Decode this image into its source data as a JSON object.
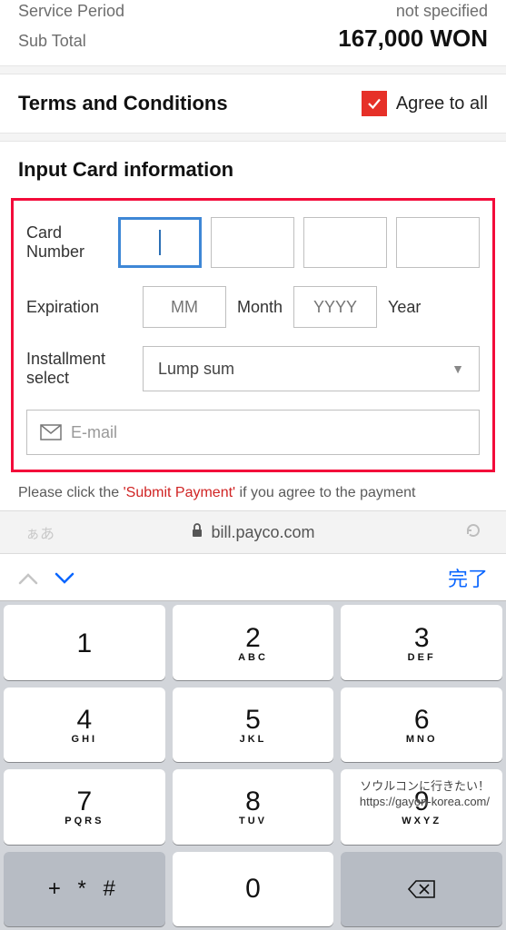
{
  "summary": {
    "service_period_label": "Service Period",
    "service_period_value": "not specified",
    "subtotal_label": "Sub Total",
    "subtotal_value": "167,000 WON"
  },
  "terms": {
    "title": "Terms and Conditions",
    "agree_label": "Agree to all",
    "checked": true
  },
  "card": {
    "section_title": "Input Card information",
    "number_label": "Card Number",
    "expiration_label": "Expiration",
    "mm_placeholder": "MM",
    "month_text": "Month",
    "yyyy_placeholder": "YYYY",
    "year_text": "Year",
    "installment_label": "Installment select",
    "installment_value": "Lump sum",
    "email_placeholder": "E-mail"
  },
  "note": {
    "prefix": "Please click the ",
    "highlight": "'Submit Payment'",
    "suffix": " if you agree to the payment"
  },
  "browser": {
    "domain": "bill.payco.com",
    "ime_hint": "ぁあ"
  },
  "accessory": {
    "done": "完了"
  },
  "keyboard": {
    "rows": [
      [
        {
          "n": "1",
          "s": ""
        },
        {
          "n": "2",
          "s": "ABC"
        },
        {
          "n": "3",
          "s": "DEF"
        }
      ],
      [
        {
          "n": "4",
          "s": "GHI"
        },
        {
          "n": "5",
          "s": "JKL"
        },
        {
          "n": "6",
          "s": "MNO"
        }
      ],
      [
        {
          "n": "7",
          "s": "PQRS"
        },
        {
          "n": "8",
          "s": "TUV"
        },
        {
          "n": "9",
          "s": "WXYZ"
        }
      ]
    ],
    "symbols": "+ * #",
    "zero": "0"
  },
  "watermark": {
    "line1": "ソウルコンに行きたい！",
    "line2": "https://gayon-korea.com/"
  }
}
